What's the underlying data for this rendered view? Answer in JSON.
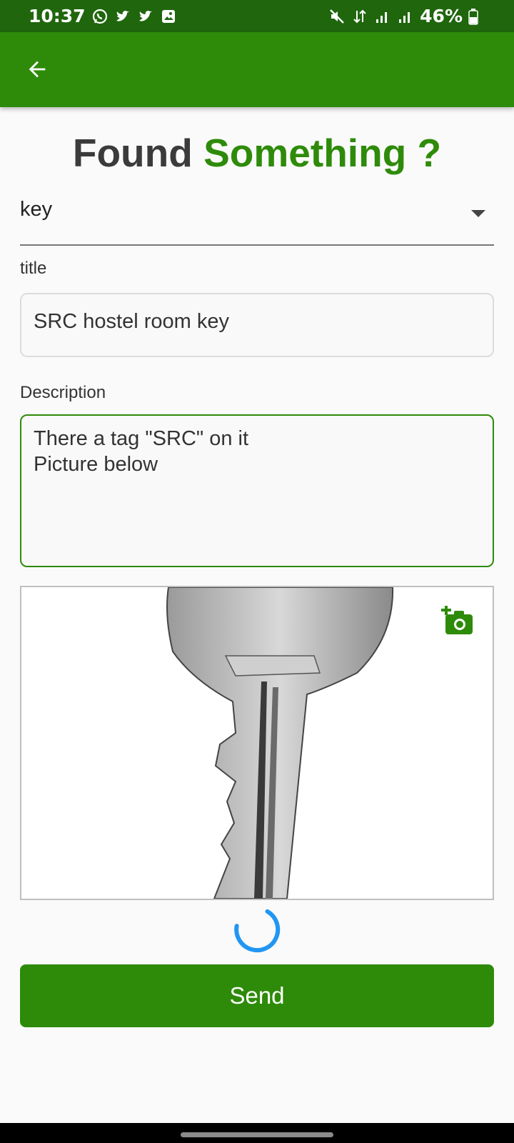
{
  "status_bar": {
    "time": "10:37",
    "battery": "46%",
    "left_icons": [
      "whatsapp-icon",
      "twitter-icon",
      "twitter-icon",
      "gallery-icon"
    ],
    "right_icons": [
      "mute-icon",
      "data-arrows-icon",
      "signal-icon",
      "signal-icon",
      "battery-icon"
    ]
  },
  "app_bar": {
    "back_icon": "arrow-left-icon",
    "color": "#2e8b0a"
  },
  "header": {
    "title_part1": "Found ",
    "title_part2": "Something ?",
    "accent_color": "#2e8b0a"
  },
  "category": {
    "selected": "key"
  },
  "title_field": {
    "label": "title",
    "value": "SRC hostel room key"
  },
  "description_field": {
    "label": "Description",
    "value": "There a tag \"SRC\" on it\nPicture below"
  },
  "image": {
    "subject": "key-photo",
    "add_icon": "add-photo-icon"
  },
  "loading": {
    "color": "#2196f3"
  },
  "send_button": {
    "label": "Send"
  }
}
